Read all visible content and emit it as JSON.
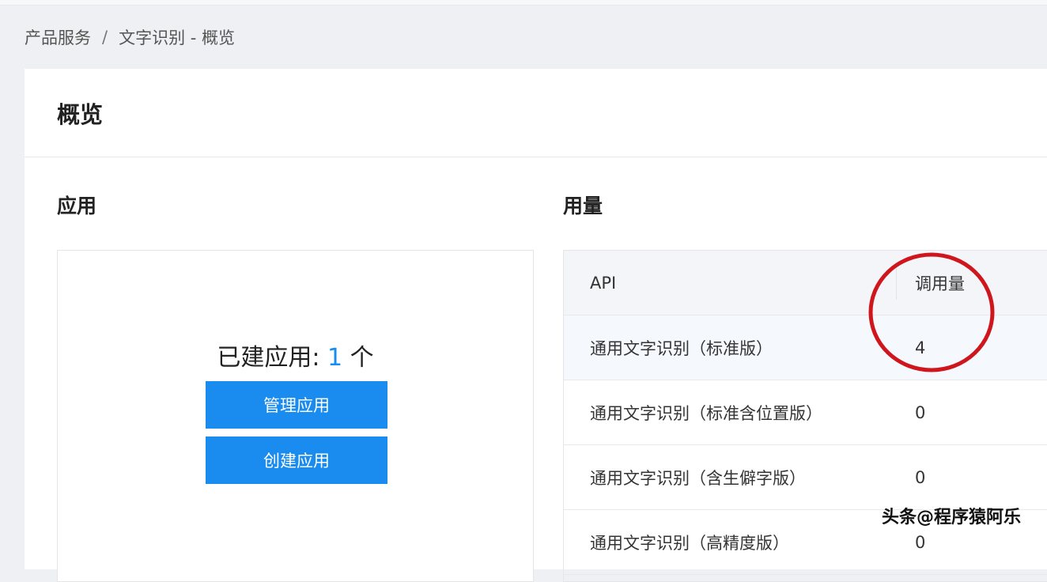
{
  "breadcrumb": {
    "items": [
      "产品服务",
      "文字识别 - 概览"
    ],
    "separator": "/"
  },
  "page": {
    "title": "概览"
  },
  "apps": {
    "section_title": "应用",
    "count_prefix": "已建应用:",
    "count_value": "1",
    "count_suffix": "个",
    "manage_button": "管理应用",
    "create_button": "创建应用"
  },
  "usage": {
    "section_title": "用量",
    "columns": [
      "API",
      "调用量"
    ],
    "rows": [
      {
        "api": "通用文字识别（标准版）",
        "count": "4"
      },
      {
        "api": "通用文字识别（标准含位置版）",
        "count": "0"
      },
      {
        "api": "通用文字识别（含生僻字版）",
        "count": "0"
      },
      {
        "api": "通用文字识别（高精度版）",
        "count": "0"
      }
    ]
  },
  "watermark": "头条@程序猿阿乐",
  "colors": {
    "accent": "#1a8cf0",
    "annotation_circle": "#d0161d"
  }
}
